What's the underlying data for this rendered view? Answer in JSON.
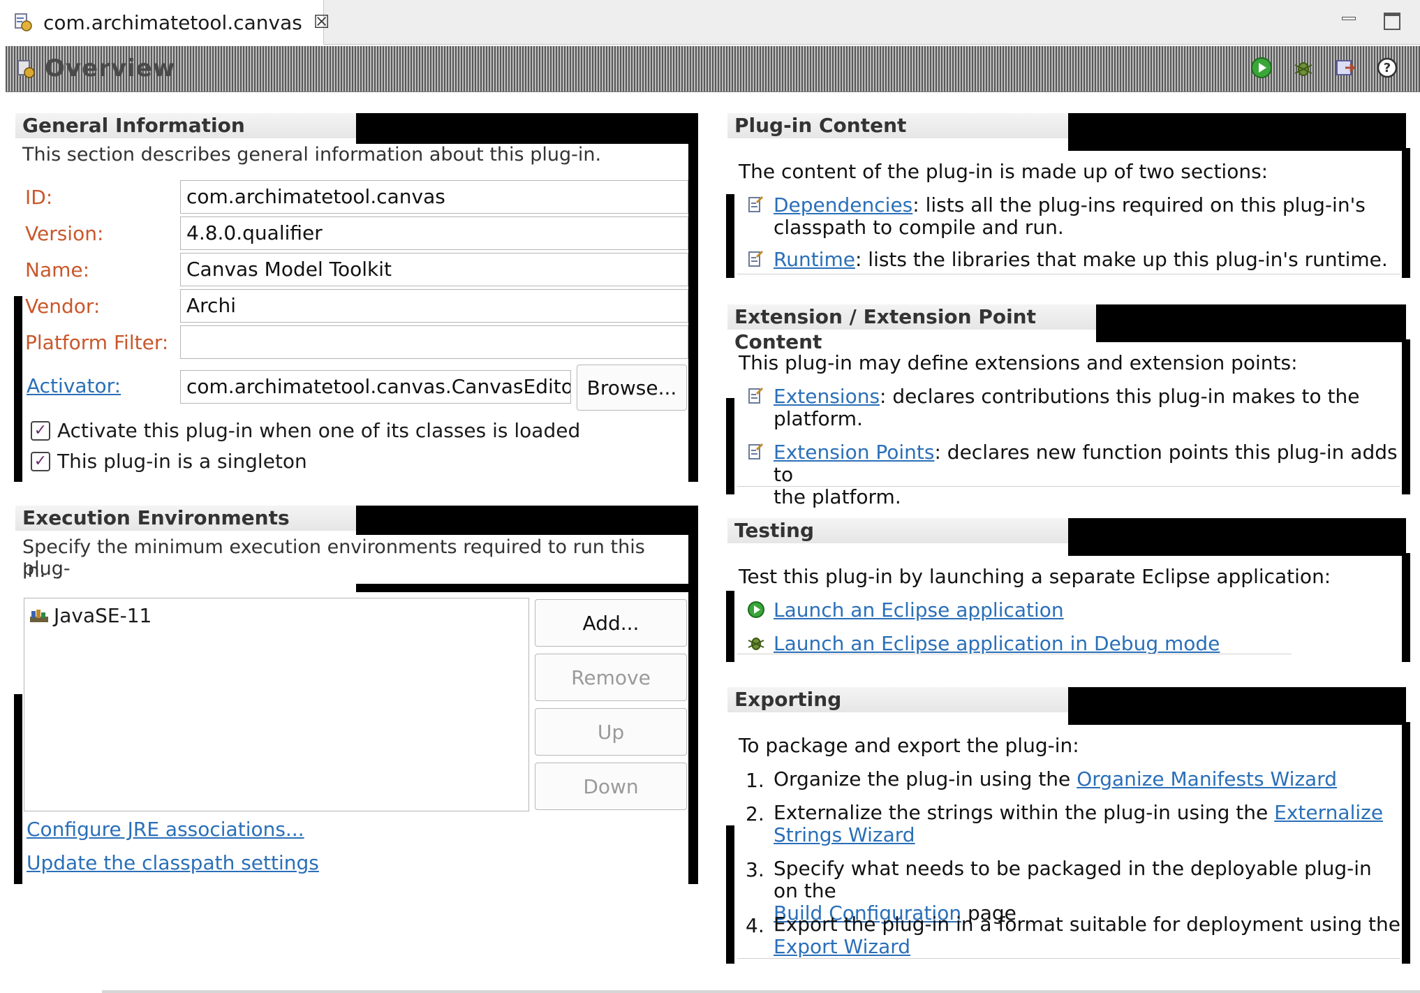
{
  "tab": {
    "title": "com.archimatetool.canvas",
    "close_icon": "close-icon"
  },
  "header": {
    "title": "Overview"
  },
  "general": {
    "title": "General Information",
    "description": "This section describes general information about this plug-in.",
    "id_label": "ID:",
    "id_value": "com.archimatetool.canvas",
    "version_label": "Version:",
    "version_value": "4.8.0.qualifier",
    "name_label": "Name:",
    "name_value": "Canvas Model Toolkit",
    "vendor_label": "Vendor:",
    "vendor_value": "Archi",
    "platform_label": "Platform Filter:",
    "platform_value": "",
    "activator_label": "Activator:",
    "activator_value": "com.archimatetool.canvas.CanvasEditorPlugin",
    "browse_label": "Browse...",
    "check1_label": "Activate this plug-in when one of its classes is loaded",
    "check2_label": "This plug-in is a singleton"
  },
  "execution": {
    "title": "Execution Environments",
    "description_line1": "Specify the minimum execution environments required to run this plug-",
    "description_line2": "in.",
    "item": "JavaSE-11",
    "add_label": "Add...",
    "remove_label": "Remove",
    "up_label": "Up",
    "down_label": "Down",
    "link_jre": "Configure JRE associations...",
    "link_classpath": "Update the classpath settings"
  },
  "content": {
    "title": "Plug-in Content",
    "intro": "The content of the plug-in is made up of two sections:",
    "dep_link": "Dependencies",
    "dep_text_1": ": lists all the plug-ins required on this plug-in's",
    "dep_text_2": "classpath to compile and run.",
    "rt_link": "Runtime",
    "rt_text": ": lists the libraries that make up this plug-in's runtime."
  },
  "extension": {
    "title": "Extension / Extension Point Content",
    "intro": "This plug-in may define extensions and extension points:",
    "ext_link": "Extensions",
    "ext_text_1": ": declares contributions this plug-in makes to the",
    "ext_text_2": "platform.",
    "pts_link": "Extension Points",
    "pts_text_1": ": declares new function points this plug-in adds to",
    "pts_text_2": "the platform."
  },
  "testing": {
    "title": "Testing",
    "intro": "Test this plug-in by launching a separate Eclipse application:",
    "launch_link": "Launch an Eclipse application",
    "debug_link": "Launch an Eclipse application in Debug mode"
  },
  "exporting": {
    "title": "Exporting",
    "intro": "To package and export the plug-in:",
    "step1_num": "1.",
    "step1_text": "Organize the plug-in using the ",
    "step1_link": "Organize Manifests Wizard",
    "step2_num": "2.",
    "step2_text": "Externalize the strings within the plug-in using the ",
    "step2_link_1": "Externalize",
    "step2_link_2": "Strings Wizard",
    "step3_num": "3.",
    "step3_text": "Specify what needs to be packaged in the deployable plug-in on the",
    "step3_link": "Build Configuration",
    "step3_tail": " page",
    "step4_num": "4.",
    "step4_text": "Export the plug-in in a format suitable for deployment using the",
    "step4_link": "Export Wizard"
  },
  "colors": {
    "label": "#c9572b",
    "link": "#2a6fb8",
    "redaction": "#000000"
  }
}
